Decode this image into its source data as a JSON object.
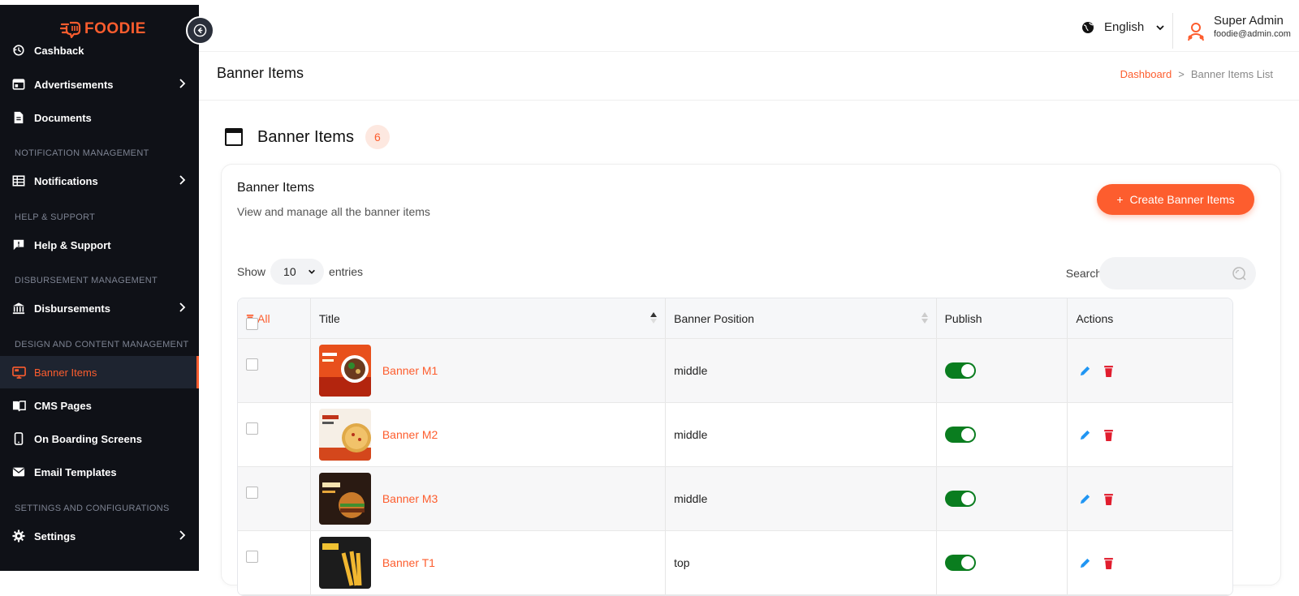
{
  "app": {
    "brand": "FOODIE"
  },
  "colors": {
    "accent": "#fd5d2e",
    "sidebar_bg": "#0f1117",
    "toggle_on": "#0a7d1f",
    "delete": "#e11d2e",
    "edit": "#2196f3"
  },
  "sidebar": {
    "items": [
      {
        "label": "Cashback",
        "icon": "cashback-icon"
      },
      {
        "label": "Advertisements",
        "icon": "advertisement-icon",
        "has_submenu": true
      },
      {
        "label": "Documents",
        "icon": "document-icon"
      },
      {
        "label": "Notifications",
        "icon": "notification-table-icon",
        "has_submenu": true
      },
      {
        "label": "Help & Support",
        "icon": "support-chat-icon"
      },
      {
        "label": "Disbursements",
        "icon": "bank-icon",
        "has_submenu": true
      },
      {
        "label": "Banner Items",
        "icon": "monitor-icon",
        "active": true
      },
      {
        "label": "CMS Pages",
        "icon": "book-icon"
      },
      {
        "label": "On Boarding Screens",
        "icon": "phone-icon"
      },
      {
        "label": "Email Templates",
        "icon": "mail-icon"
      },
      {
        "label": "Settings",
        "icon": "gear-icon",
        "has_submenu": true
      }
    ],
    "sections": {
      "notification": "NOTIFICATION MANAGEMENT",
      "help": "HELP & SUPPORT",
      "disbursement": "DISBURSEMENT MANAGEMENT",
      "design": "DESIGN AND CONTENT MANAGEMENT",
      "settings": "SETTINGS AND CONFIGURATIONS"
    }
  },
  "header": {
    "language": "English",
    "user_name": "Super Admin",
    "user_email": "foodie@admin.com"
  },
  "page": {
    "title": "Banner Items",
    "breadcrumb_home": "Dashboard",
    "breadcrumb_sep": ">",
    "breadcrumb_current": "Banner Items List"
  },
  "section": {
    "title": "Banner Items",
    "count": "6"
  },
  "card": {
    "title": "Banner Items",
    "subtitle": "View and manage all the banner items",
    "create_label": "Create Banner Items",
    "create_plus": "+"
  },
  "controls": {
    "show_label": "Show",
    "page_size": "10",
    "entries_label": "entries",
    "search_label": "Search:",
    "search_value": ""
  },
  "table": {
    "headers": {
      "all": "All",
      "title": "Title",
      "position": "Banner Position",
      "publish": "Publish",
      "actions": "Actions"
    },
    "rows": [
      {
        "title": "Banner M1",
        "position": "middle",
        "published": true
      },
      {
        "title": "Banner M2",
        "position": "middle",
        "published": true
      },
      {
        "title": "Banner M3",
        "position": "middle",
        "published": true
      },
      {
        "title": "Banner T1",
        "position": "top",
        "published": true
      }
    ]
  }
}
